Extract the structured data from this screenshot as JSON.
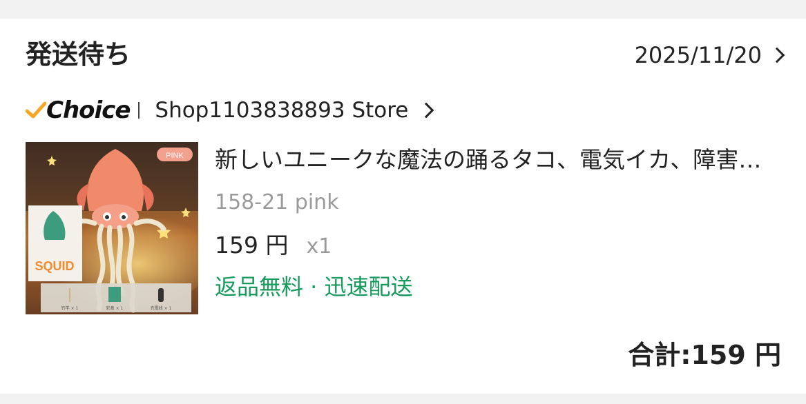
{
  "order": {
    "status": "発送待ち",
    "date": "2025/11/20"
  },
  "store": {
    "badge": "Choice",
    "name": "Shop1103838893 Store"
  },
  "product": {
    "title": "新しいユニークな魔法の踊るタコ、電気イカ、障害物回避機能付き",
    "variant": "158-21 pink",
    "price": "159 円",
    "quantity": "x1",
    "perks": "返品無料 · 迅速配送",
    "image_tag": "PINK",
    "box_label": "SQUID",
    "accessories": [
      "钓竿 × 1",
      "彩盒 × 1",
      "充電线 × 1"
    ]
  },
  "summary": {
    "total": "合計:159 円"
  },
  "colors": {
    "choice_check": "#f5a623",
    "perks_green": "#149a5a",
    "muted": "#9a9a9a"
  }
}
